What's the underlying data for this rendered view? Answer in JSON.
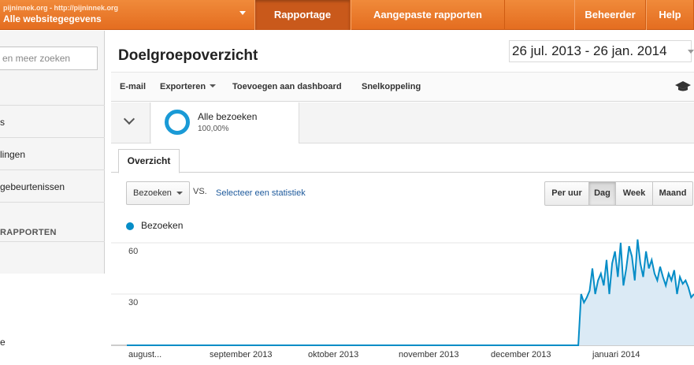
{
  "header": {
    "account_url": "pijninnek.org - http://pijninnek.org",
    "account_view": "Alle websitegegevens",
    "nav": [
      "Rapportage",
      "Aangepaste rapporten",
      "Beheerder",
      "Help"
    ],
    "accent_color": "#e8762a"
  },
  "sidebar": {
    "search_placeholder": "en meer zoeken",
    "items": [
      "s",
      "lingen",
      "gebeurtenissen"
    ],
    "heading": "RAPPORTEN",
    "bottom_item": "e"
  },
  "main": {
    "title": "Doelgroepoverzicht",
    "date_range": "26 jul. 2013 - 26 jan. 2014",
    "toolbar": {
      "email": "E-mail",
      "export": "Exporteren",
      "dashboard": "Toevoegen aan dashboard",
      "shortcut": "Snelkoppeling"
    },
    "segment": {
      "name": "Alle bezoeken",
      "percent": "100,00%"
    },
    "tab": "Overzicht",
    "metric": "Bezoeken",
    "vs": "VS.",
    "compare_link": "Selecteer een statistiek",
    "granularity": {
      "options": [
        "Per uur",
        "Dag",
        "Week",
        "Maand"
      ],
      "selected": "Dag"
    },
    "legend": "Bezoeken"
  },
  "chart_data": {
    "type": "area",
    "series": [
      {
        "name": "Bezoeken",
        "color": "#058dc7",
        "values": [
          0,
          0,
          0,
          0,
          0,
          0,
          0,
          0,
          0,
          0,
          0,
          0,
          0,
          0,
          0,
          0,
          0,
          0,
          0,
          0,
          0,
          0,
          0,
          0,
          0,
          0,
          0,
          0,
          0,
          0,
          0,
          0,
          0,
          0,
          0,
          0,
          0,
          0,
          0,
          0,
          0,
          0,
          0,
          0,
          0,
          0,
          0,
          0,
          0,
          0,
          0,
          0,
          0,
          0,
          0,
          0,
          0,
          0,
          0,
          0,
          0,
          0,
          0,
          0,
          0,
          0,
          0,
          0,
          0,
          0,
          0,
          0,
          0,
          0,
          0,
          0,
          0,
          0,
          0,
          0,
          0,
          0,
          0,
          0,
          0,
          0,
          0,
          0,
          0,
          0,
          0,
          0,
          0,
          0,
          0,
          0,
          0,
          0,
          0,
          0,
          0,
          0,
          0,
          0,
          0,
          0,
          0,
          0,
          0,
          0,
          0,
          0,
          0,
          0,
          0,
          0,
          0,
          0,
          0,
          0,
          0,
          0,
          0,
          0,
          0,
          0,
          0,
          0,
          0,
          0,
          0,
          0,
          0,
          0,
          0,
          0,
          0,
          0,
          0,
          0,
          0,
          0,
          0,
          0,
          0,
          0,
          0,
          0,
          0,
          0,
          0,
          0,
          0,
          0,
          0,
          0,
          0,
          0,
          0,
          0,
          0,
          30,
          25,
          28,
          32,
          45,
          30,
          38,
          42,
          35,
          50,
          30,
          48,
          55,
          40,
          60,
          35,
          45,
          58,
          52,
          38,
          62,
          48,
          40,
          55,
          45,
          50,
          42,
          38,
          46,
          40,
          35,
          42,
          38,
          44,
          30,
          40,
          36,
          38,
          34,
          28,
          30
        ]
      }
    ],
    "x_tick_labels": [
      "august...",
      "september 2013",
      "oktober 2013",
      "november 2013",
      "december 2013",
      "januari 2014"
    ],
    "y_tick_labels": [
      "60",
      "30"
    ],
    "ylim": [
      0,
      60
    ],
    "grid": true
  }
}
